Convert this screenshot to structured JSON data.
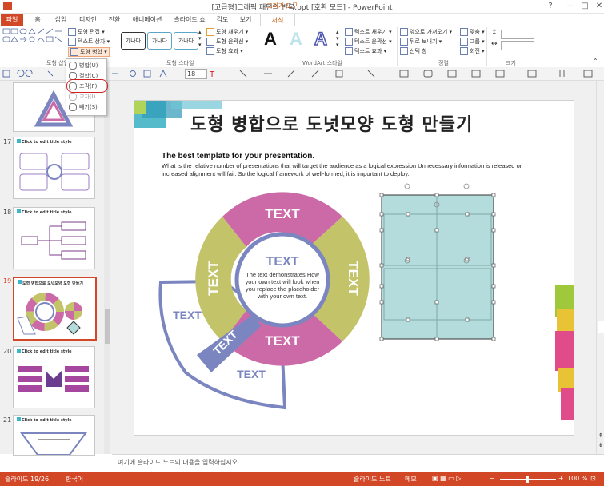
{
  "window": {
    "title": "[고급형]그래픽 패턴의 반복.ppt [호환 모드] - PowerPoint",
    "context_tab_group": "그리기 도구"
  },
  "tabs": [
    "파일",
    "홈",
    "삽입",
    "디자인",
    "전환",
    "애니메이션",
    "슬라이드 쇼",
    "검토",
    "보기",
    "서식"
  ],
  "ribbon": {
    "insert_shapes": {
      "edit_shape": "도형 편집",
      "text_box": "텍스트 상자",
      "merge_shapes": "도형 병합",
      "label": "도형 삽입"
    },
    "shape_styles": {
      "style_text": "가나다",
      "fill": "도형 채우기",
      "outline": "도형 윤곽선",
      "effects": "도형 효과",
      "label": "도형 스타일"
    },
    "wordart": {
      "sample": "A",
      "text_fill": "텍스트 채우기",
      "text_outline": "텍스트 윤곽선",
      "text_effects": "텍스트 효과",
      "label": "WordArt 스타일"
    },
    "arrange": {
      "bring_forward": "앞으로 가져오기",
      "send_backward": "뒤로 보내기",
      "selection_pane": "선택 창",
      "align": "맞춤",
      "group": "그룹",
      "rotate": "회전",
      "label": "정렬"
    },
    "size": {
      "label": "크기"
    }
  },
  "qat": {
    "font_size": "18"
  },
  "merge_menu": [
    "병합(U)",
    "결합(C)",
    "조각(F)",
    "교차(I)",
    "빼기(S)"
  ],
  "thumbnails": [
    {
      "num": "",
      "title": ""
    },
    {
      "num": "17",
      "title": "Click to edit title style"
    },
    {
      "num": "18",
      "title": "Click to edit title style"
    },
    {
      "num": "19",
      "title": "도형 병합으로 도넛모양 도형 만들기"
    },
    {
      "num": "20",
      "title": "Click to edit title style"
    },
    {
      "num": "21",
      "title": "Click to edit title style"
    }
  ],
  "slide": {
    "title": "도형 병합으로 도넛모양 도형 만들기",
    "subtitle": "The best template for your presentation.",
    "body": "What is the relative number of presentations that will target the audience as a logical expression Unnecessary information is released or increased alignment will fail. So the logical framework of well-formed, it is important to deploy.",
    "donut": {
      "segments": [
        "TEXT",
        "TEXT",
        "TEXT",
        "TEXT"
      ],
      "center_title": "TEXT",
      "center_body": [
        "The text demonstrates How",
        "your own text will look when",
        "you replace the placeholder",
        "with your own text."
      ],
      "wedge_labels": [
        "TEXT",
        "TEXT",
        "TEXT"
      ]
    },
    "colors": {
      "pink": "#cc6aa8",
      "olive": "#c3c36a",
      "navy": "#7b86c0",
      "teal": "#b4dcdc"
    }
  },
  "notes": "여기에 슬라이드 노트의 내용을 입력하십시오",
  "status": {
    "slide": "슬라이드 19/26",
    "language": "한국어",
    "notes": "슬라이드 노트",
    "memo": "메모",
    "zoom": "100 %"
  }
}
